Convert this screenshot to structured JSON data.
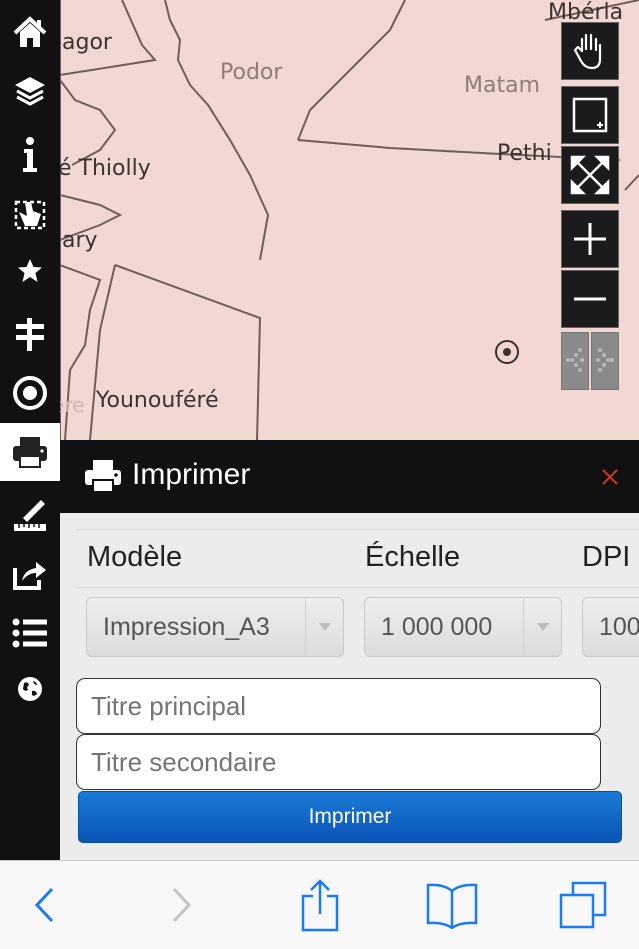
{
  "map": {
    "places": [
      "Mbérla",
      "agor",
      "Podor",
      "Matam",
      "é Thiolly",
      "Pethi",
      "ary",
      "Younouféré",
      "ere"
    ],
    "background_color": "#f2d8d2"
  },
  "map_toolbar": {
    "icons": [
      "pan-hand-icon",
      "zoom-box-icon",
      "full-extent-icon",
      "zoom-in-icon",
      "zoom-out-icon",
      "history-back-icon",
      "history-forward-icon"
    ]
  },
  "sidebar": {
    "items": [
      "home-icon",
      "layers-icon",
      "info-icon",
      "select-icon",
      "favorite-icon",
      "signpost-icon",
      "target-icon",
      "print-icon",
      "measure-icon",
      "share-icon",
      "list-icon",
      "globe-icon"
    ],
    "active": "print-icon"
  },
  "panel": {
    "title": "Imprimer",
    "columns": {
      "model_label": "Modèle",
      "scale_label": "Échelle",
      "dpi_label": "DPI"
    },
    "model_value": "Impression_A3",
    "scale_value": "1 000 000",
    "dpi_value": "100",
    "title_placeholder": "Titre principal",
    "subtitle_placeholder": "Titre secondaire",
    "print_button": "Imprimer"
  },
  "colors": {
    "dark": "#111111",
    "accent_blue": "#1a7ad6",
    "close_red": "#c0392b",
    "ios_blue": "#1a7bf2"
  }
}
